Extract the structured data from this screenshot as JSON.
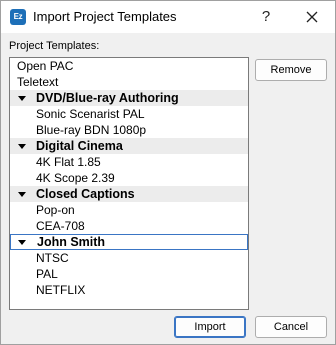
{
  "window": {
    "title": "Import Project Templates",
    "app_icon_text": "Ez",
    "help_label": "?",
    "accent": "#3a75c4"
  },
  "list_label": "Project Templates:",
  "list_items": [
    {
      "kind": "top",
      "label": "Open PAC"
    },
    {
      "kind": "top",
      "label": "Teletext"
    },
    {
      "kind": "group",
      "label": "DVD/Blue-ray Authoring",
      "expanded": true
    },
    {
      "kind": "child",
      "label": "Sonic Scenarist PAL"
    },
    {
      "kind": "child",
      "label": "Blue-ray BDN 1080p"
    },
    {
      "kind": "group",
      "label": "Digital Cinema",
      "expanded": true
    },
    {
      "kind": "child",
      "label": "4K Flat 1.85"
    },
    {
      "kind": "child",
      "label": "4K Scope 2.39"
    },
    {
      "kind": "group",
      "label": "Closed Captions",
      "expanded": true
    },
    {
      "kind": "child",
      "label": "Pop-on"
    },
    {
      "kind": "child",
      "label": "CEA-708"
    },
    {
      "kind": "group",
      "label": "John Smith",
      "expanded": true,
      "selected": true
    },
    {
      "kind": "child",
      "label": "NTSC"
    },
    {
      "kind": "child",
      "label": "PAL"
    },
    {
      "kind": "child",
      "label": "NETFLIX"
    }
  ],
  "buttons": {
    "remove": "Remove",
    "import": "Import",
    "cancel": "Cancel"
  }
}
